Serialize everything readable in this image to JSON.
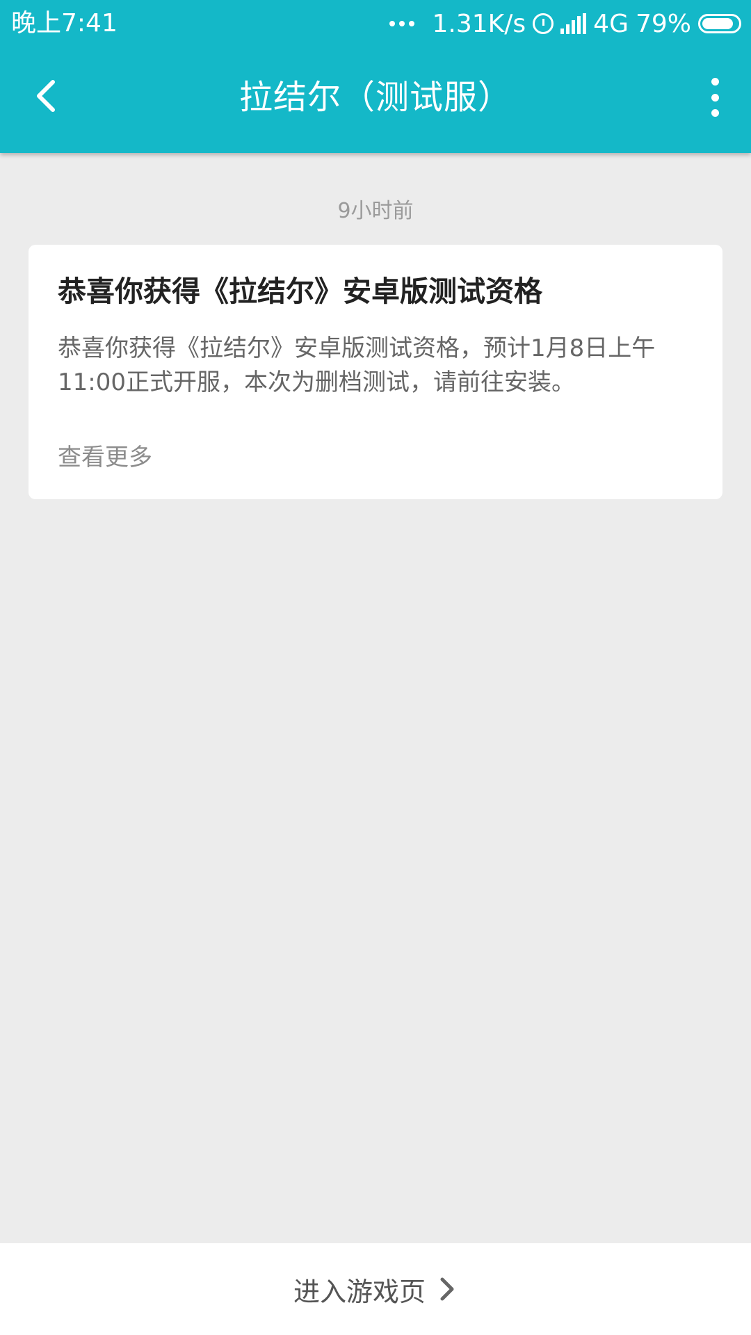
{
  "status_bar": {
    "time": "晚上7:41",
    "speed": "1.31K/s",
    "network": "4G",
    "battery": "79%"
  },
  "header": {
    "title": "拉结尔（测试服）"
  },
  "message": {
    "timestamp": "9小时前",
    "title": "恭喜你获得《拉结尔》安卓版测试资格",
    "body": "恭喜你获得《拉结尔》安卓版测试资格，预计1月8日上午11:00正式开服，本次为删档测试，请前往安装。",
    "more_label": "查看更多"
  },
  "footer": {
    "enter_game_label": "进入游戏页"
  },
  "colors": {
    "accent": "#14b8c8",
    "background": "#ececec"
  }
}
